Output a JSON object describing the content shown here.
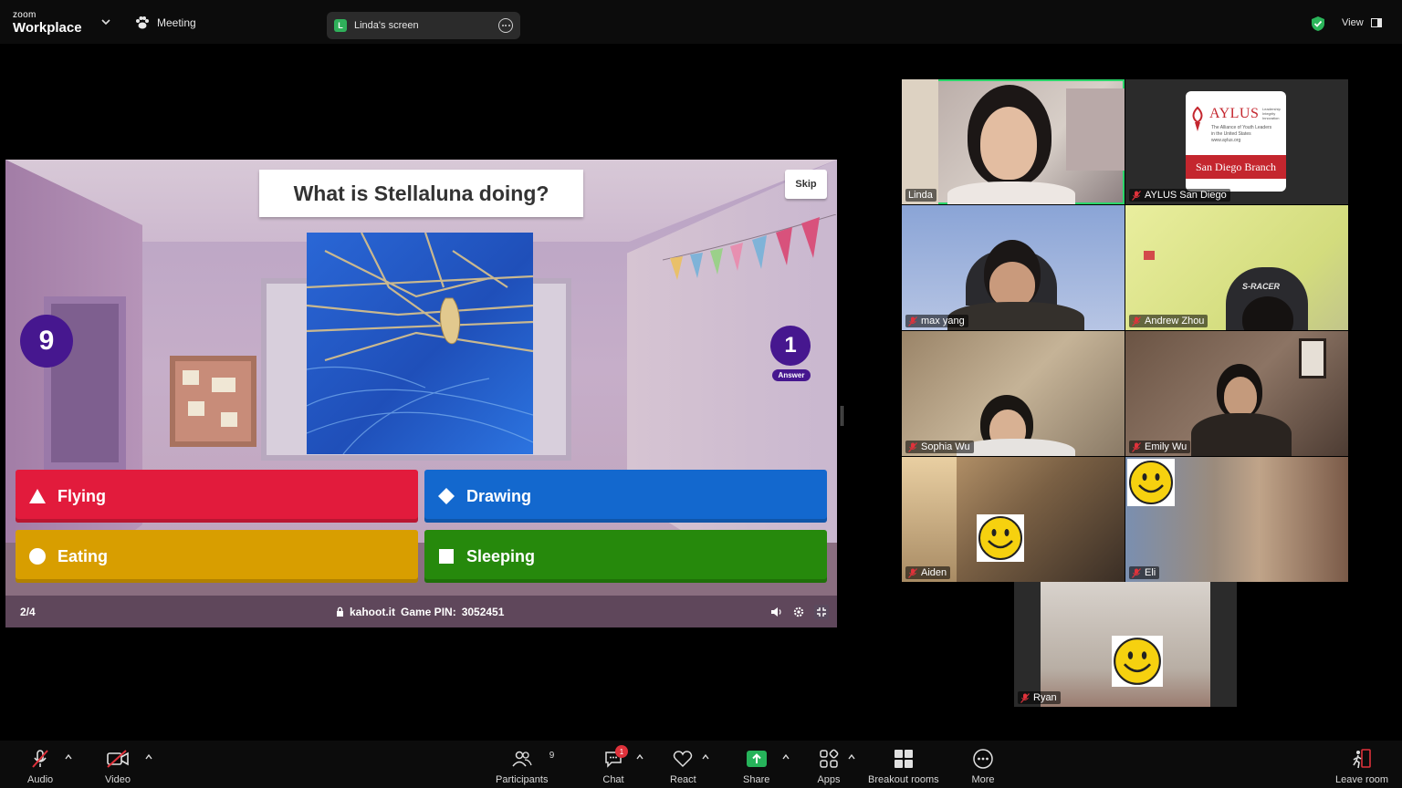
{
  "topbar": {
    "brand_small": "zoom",
    "brand_big": "Workplace",
    "meeting_label": "Meeting",
    "screen_badge": "L",
    "screen_label": "Linda's screen",
    "view_label": "View"
  },
  "kahoot": {
    "question": "What is Stellaluna doing?",
    "skip_label": "Skip",
    "timer": "9",
    "answer_count": "1",
    "answer_count_label": "Answer",
    "answers": [
      {
        "label": "Flying",
        "shape": "triangle",
        "color": "#e21b3c"
      },
      {
        "label": "Drawing",
        "shape": "diamond",
        "color": "#1368ce"
      },
      {
        "label": "Eating",
        "shape": "circle",
        "color": "#d89e00"
      },
      {
        "label": "Sleeping",
        "shape": "square",
        "color": "#26890c"
      }
    ],
    "progress": "2/4",
    "site": "kahoot.it",
    "pin_label": "Game PIN:",
    "pin": "3052451"
  },
  "gallery": {
    "participants": [
      {
        "name": "Linda",
        "muted": false,
        "speaking": true
      },
      {
        "name": "AYLUS San Diego",
        "muted": true
      },
      {
        "name": "max yang",
        "muted": true
      },
      {
        "name": "Andrew Zhou",
        "muted": true
      },
      {
        "name": "Sophia Wu",
        "muted": true
      },
      {
        "name": "Emily Wu",
        "muted": true
      },
      {
        "name": "Aiden",
        "muted": true
      },
      {
        "name": "Eli",
        "muted": true
      },
      {
        "name": "Ryan",
        "muted": true
      }
    ],
    "aylus_logo": {
      "title": "AYLUS",
      "tagline_1": "Leadership",
      "tagline_2": "Integrity",
      "tagline_3": "Innovation",
      "subtitle_1": "The Alliance of Youth Leaders",
      "subtitle_2": "in the United States",
      "url": "www.aylus.org",
      "branch": "San Diego Branch"
    },
    "chair_brand": "S-RACER"
  },
  "toolbar": {
    "audio": "Audio",
    "video": "Video",
    "participants": "Participants",
    "participants_count": "9",
    "chat": "Chat",
    "chat_badge": "1",
    "react": "React",
    "share": "Share",
    "apps": "Apps",
    "breakout": "Breakout rooms",
    "more": "More",
    "leave": "Leave room"
  },
  "colors": {
    "kahoot_purple": "#46178f",
    "speaking_green": "#2bd56a",
    "share_green": "#26b35a",
    "mute_red": "#e0323b"
  }
}
